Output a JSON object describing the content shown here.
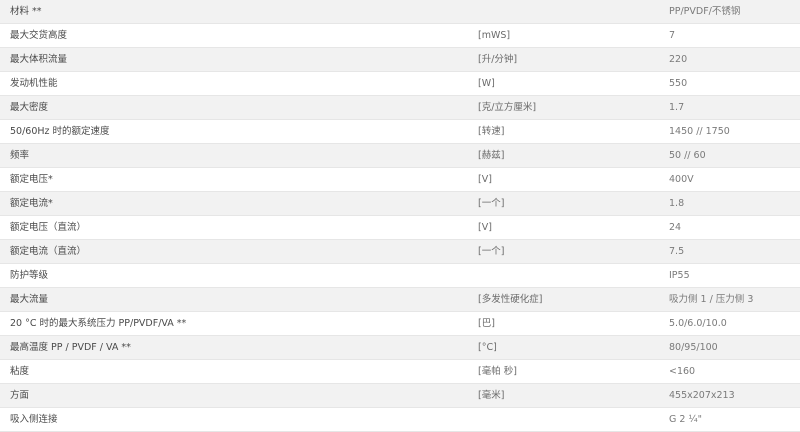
{
  "rows": [
    {
      "name": "材料 **",
      "unit": "",
      "value": "PP/PVDF/不锈钢"
    },
    {
      "name": "最大交货高度",
      "unit": "[mWS]",
      "value": "7"
    },
    {
      "name": "最大体积流量",
      "unit": "[升/分钟]",
      "value": "220"
    },
    {
      "name": "发动机性能",
      "unit": "[W]",
      "value": "550"
    },
    {
      "name": "最大密度",
      "unit": "[克/立方厘米]",
      "value": "1.7"
    },
    {
      "name": "50/60Hz 时的额定速度",
      "unit": "[转速]",
      "value": "1450 // 1750"
    },
    {
      "name": "频率",
      "unit": "[赫兹]",
      "value": "50 // 60"
    },
    {
      "name": "额定电压*",
      "unit": "[V]",
      "value": "400V"
    },
    {
      "name": "额定电流*",
      "unit": "[一个]",
      "value": "1.8"
    },
    {
      "name": "额定电压（直流）",
      "unit": "[V]",
      "value": "24"
    },
    {
      "name": "额定电流（直流）",
      "unit": "[一个]",
      "value": "7.5"
    },
    {
      "name": "防护等级",
      "unit": "",
      "value": "IP55"
    },
    {
      "name": "最大流量",
      "unit": "[多发性硬化症]",
      "value": "吸力侧 1 / 压力侧 3"
    },
    {
      "name": "20 °C 时的最大系统压力 PP/PVDF/VA **",
      "unit": "[巴]",
      "value": "5.0/6.0/10.0"
    },
    {
      "name": "最高温度 PP / PVDF / VA **",
      "unit": "[°C]",
      "value": "80/95/100"
    },
    {
      "name": "粘度",
      "unit": "[毫帕 秒]",
      "value": "<160"
    },
    {
      "name": "方面",
      "unit": "[毫米]",
      "value": "455x207x213"
    },
    {
      "name": "吸入侧连接",
      "unit": "",
      "value": "G 2 ¼\""
    }
  ]
}
